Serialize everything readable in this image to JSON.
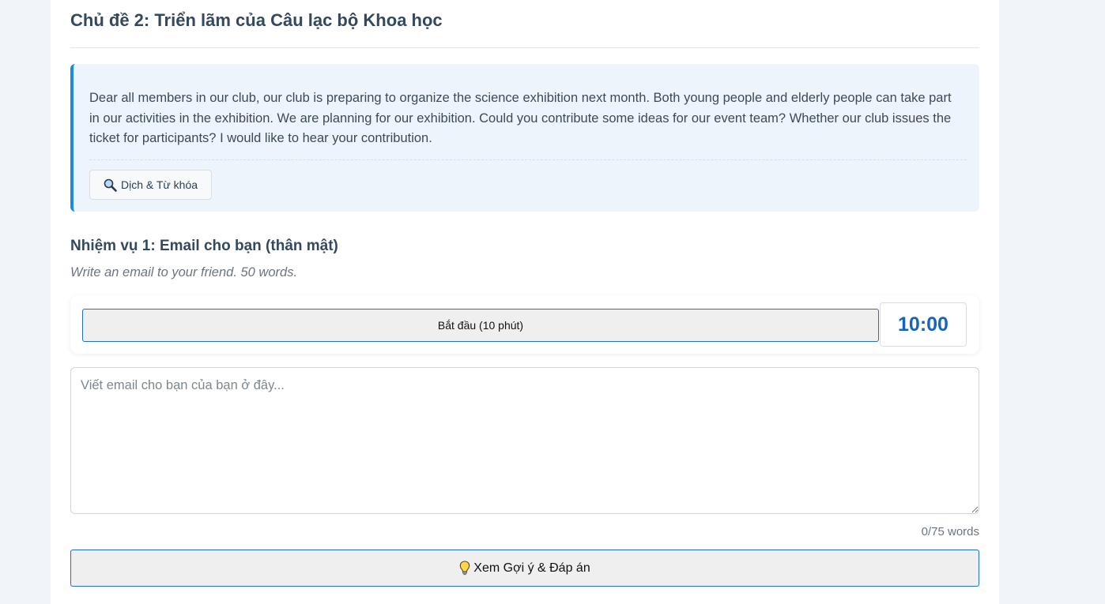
{
  "topic": {
    "title": "Chủ đề 2: Triển lãm của Câu lạc bộ Khoa học"
  },
  "prompt": {
    "text": "Dear all members in our club, our club is preparing to organize the science exhibition next month. Both young people and elderly people can take part in our activities in the exhibition. We are planning for our exhibition. Could you contribute some ideas for our event team? Whether our club issues the ticket for participants? I would like to hear your contribution.",
    "translate_button_label": "Dịch & Từ khóa",
    "translate_button_icon": "magnifier-icon"
  },
  "task": {
    "title": "Nhiệm vụ 1: Email cho bạn (thân mật)",
    "instruction": "Write an email to your friend. 50 words."
  },
  "timer": {
    "start_button_label": "Bắt đầu (10 phút)",
    "display": "10:00"
  },
  "answer": {
    "value": "",
    "placeholder": "Viết email cho bạn của bạn ở đây...",
    "word_count": "0/75 words"
  },
  "hint": {
    "button_label": "Xem Gợi ý & Đáp án",
    "button_icon": "lightbulb-icon"
  },
  "colors": {
    "accent": "#1e88e5",
    "timer_text": "#1565c0",
    "prompt_bg": "#edf4fc",
    "page_bg": "#f1f5f9"
  }
}
